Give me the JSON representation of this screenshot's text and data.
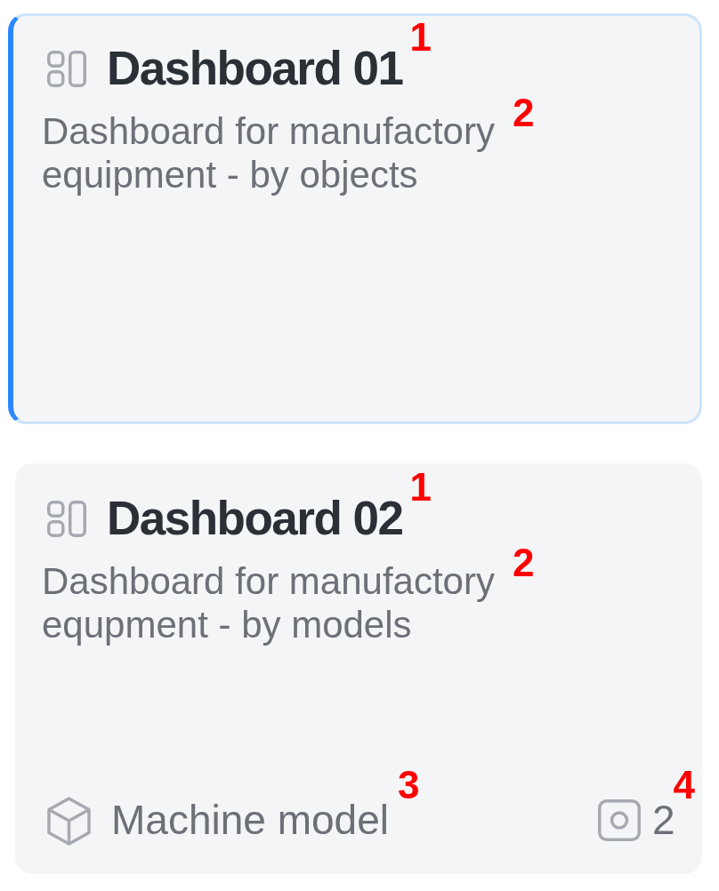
{
  "cards": [
    {
      "selected": true,
      "title": "Dashboard 01",
      "title_callout": "1",
      "description": "Dashboard for manufactory equipment - by objects",
      "description_callout": "2"
    },
    {
      "selected": false,
      "title": "Dashboard 02",
      "title_callout": "1",
      "description": "Dashboard for manufactory equpment - by models",
      "description_callout": "2",
      "footer": {
        "category": "Machine model",
        "category_callout": "3",
        "count": "2",
        "count_callout": "4"
      }
    }
  ]
}
